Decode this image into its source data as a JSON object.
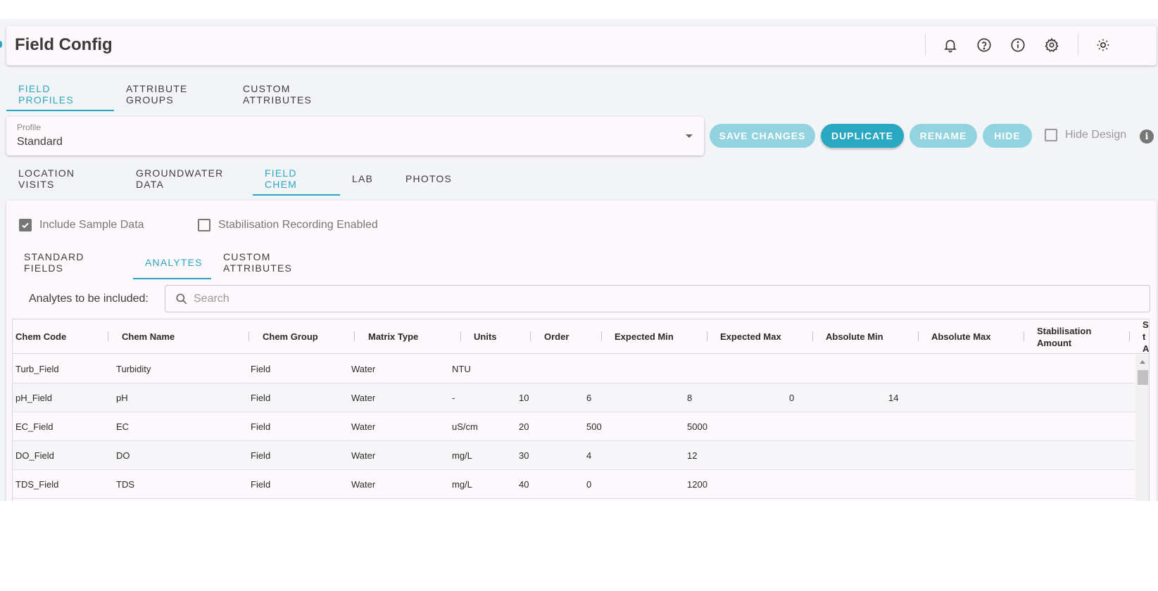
{
  "header": {
    "title": "Field Config"
  },
  "main_tabs": [
    {
      "label": "FIELD PROFILES",
      "active": true
    },
    {
      "label": "ATTRIBUTE GROUPS",
      "active": false
    },
    {
      "label": "CUSTOM ATTRIBUTES",
      "active": false
    }
  ],
  "profile": {
    "label": "Profile",
    "value": "Standard"
  },
  "actions": {
    "save": "SAVE CHANGES",
    "duplicate": "DUPLICATE",
    "rename": "RENAME",
    "hide": "HIDE",
    "hide_design": "Hide Design"
  },
  "sub_tabs": [
    {
      "label": "LOCATION VISITS",
      "active": false
    },
    {
      "label": "GROUNDWATER DATA",
      "active": false
    },
    {
      "label": "FIELD CHEM",
      "active": true
    },
    {
      "label": "LAB",
      "active": false
    },
    {
      "label": "PHOTOS",
      "active": false
    }
  ],
  "options": {
    "include_sample_data": "Include Sample Data",
    "stabilisation_enabled": "Stabilisation Recording Enabled"
  },
  "inner_tabs": [
    {
      "label": "STANDARD FIELDS",
      "active": false
    },
    {
      "label": "ANALYTES",
      "active": true
    },
    {
      "label": "CUSTOM ATTRIBUTES",
      "active": false
    }
  ],
  "analytes": {
    "label": "Analytes to be included:",
    "search_placeholder": "Search"
  },
  "grid": {
    "columns": [
      "Chem Code",
      "Chem Name",
      "Chem Group",
      "Matrix Type",
      "Units",
      "Order",
      "Expected Min",
      "Expected Max",
      "Absolute Min",
      "Absolute Max",
      "Stabilisation Amount",
      "St A"
    ],
    "rows": [
      [
        "Turb_Field",
        "Turbidity",
        "Field",
        "Water",
        "NTU",
        "",
        "",
        "",
        "",
        "",
        "",
        ""
      ],
      [
        "pH_Field",
        "pH",
        "Field",
        "Water",
        "-",
        "10",
        "6",
        "8",
        "0",
        "14",
        "",
        ""
      ],
      [
        "EC_Field",
        "EC",
        "Field",
        "Water",
        "uS/cm",
        "20",
        "500",
        "5000",
        "",
        "",
        "",
        ""
      ],
      [
        "DO_Field",
        "DO",
        "Field",
        "Water",
        "mg/L",
        "30",
        "4",
        "12",
        "",
        "",
        "",
        ""
      ],
      [
        "TDS_Field",
        "TDS",
        "Field",
        "Water",
        "mg/L",
        "40",
        "0",
        "1200",
        "",
        "",
        "",
        ""
      ]
    ]
  }
}
